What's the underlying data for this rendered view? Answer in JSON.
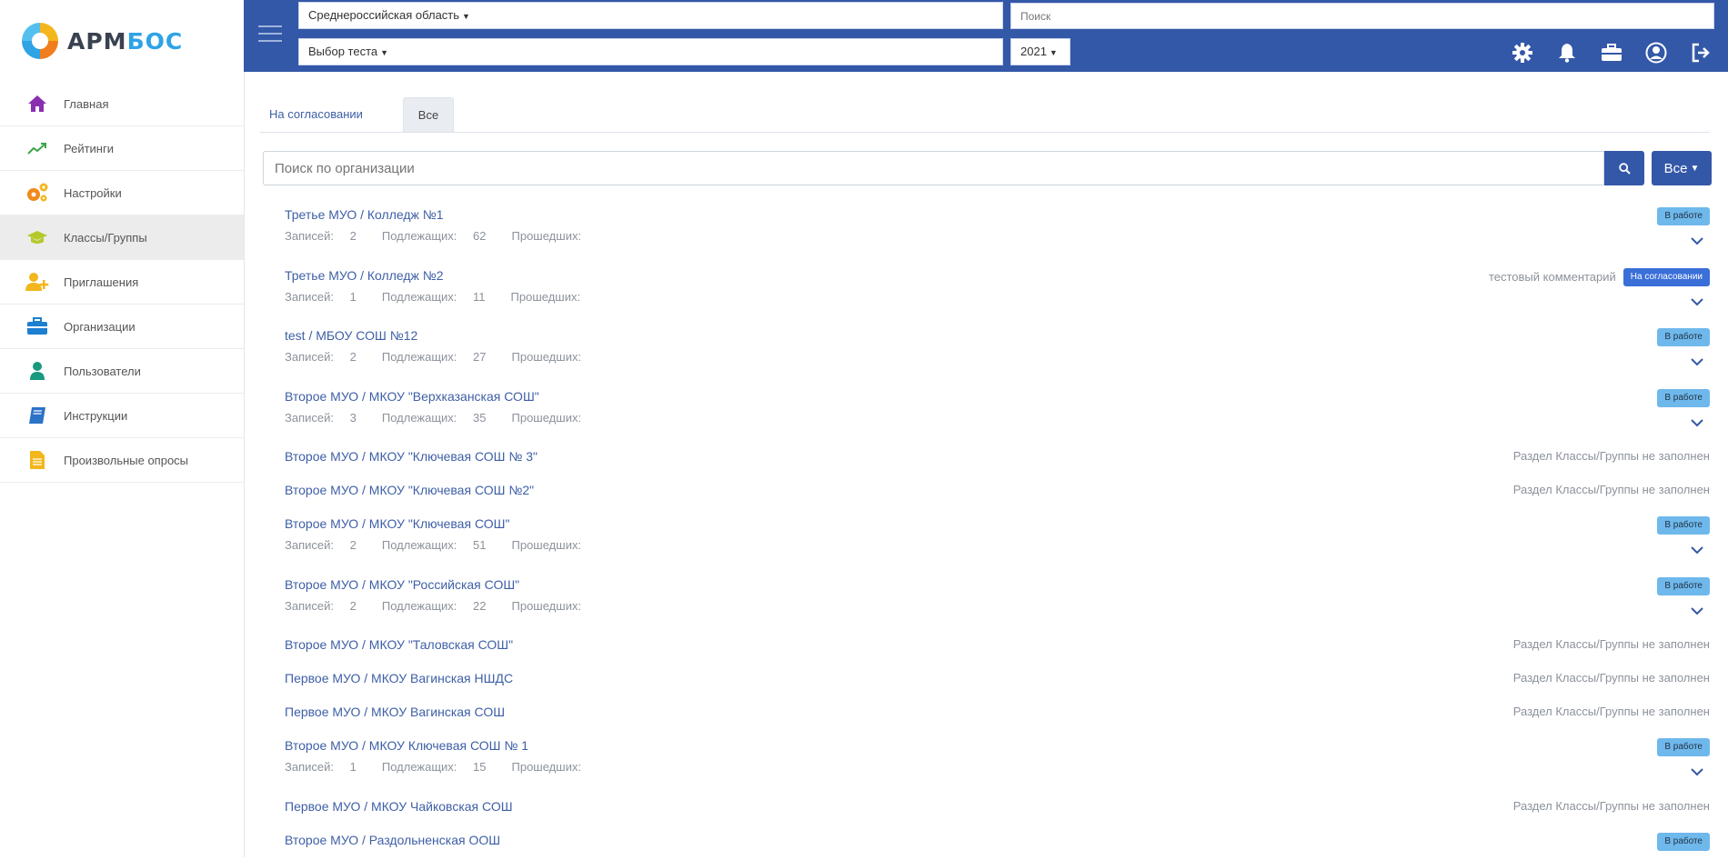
{
  "brand": {
    "part1": "АРМ",
    "part2": "БОС"
  },
  "sidebar": {
    "items": [
      {
        "label": "Главная",
        "icon": "home-icon"
      },
      {
        "label": "Рейтинги",
        "icon": "trend-icon"
      },
      {
        "label": "Настройки",
        "icon": "gears-icon"
      },
      {
        "label": "Классы/Группы",
        "icon": "graduation-cap-icon"
      },
      {
        "label": "Приглашения",
        "icon": "user-plus-icon"
      },
      {
        "label": "Организации",
        "icon": "briefcase-icon"
      },
      {
        "label": "Пользователи",
        "icon": "user-icon"
      },
      {
        "label": "Инструкции",
        "icon": "book-icon"
      },
      {
        "label": "Произвольные опросы",
        "icon": "document-icon"
      }
    ]
  },
  "header": {
    "region": "Среднероссийская область",
    "test": "Выбор теста",
    "year": "2021",
    "search_placeholder": "Поиск"
  },
  "tabs": [
    "На согласовании",
    "Все"
  ],
  "search": {
    "placeholder": "Поиск по организации",
    "filter_label": "Все"
  },
  "labels": {
    "records": "Записей:",
    "subject": "Подлежащих:",
    "passed": "Прошедших:"
  },
  "rows": [
    {
      "org": "Третье МУО / Колледж №1",
      "records": "2",
      "subject": "62",
      "status": "В работе"
    },
    {
      "org": "Третье МУО / Колледж №2",
      "records": "1",
      "subject": "11",
      "status": "На согласовании",
      "comment": "тестовый комментарий"
    },
    {
      "org": "test / МБОУ СОШ №12",
      "records": "2",
      "subject": "27",
      "status": "В работе"
    },
    {
      "org": "Второе МУО / МКОУ \"Верхказанская СОШ\"",
      "records": "3",
      "subject": "35",
      "status": "В работе"
    },
    {
      "org": "Второе МУО / МКОУ \"Ключевая СОШ № 3\"",
      "empty": "Раздел Классы/Группы не заполнен"
    },
    {
      "org": "Второе МУО / МКОУ \"Ключевая СОШ №2\"",
      "empty": "Раздел Классы/Группы не заполнен"
    },
    {
      "org": "Второе МУО / МКОУ \"Ключевая СОШ\"",
      "records": "2",
      "subject": "51",
      "status": "В работе"
    },
    {
      "org": "Второе МУО / МКОУ \"Российская СОШ\"",
      "records": "2",
      "subject": "22",
      "status": "В работе"
    },
    {
      "org": "Второе МУО / МКОУ \"Таловская СОШ\"",
      "empty": "Раздел Классы/Группы не заполнен"
    },
    {
      "org": "Первое МУО / МКОУ Вагинская НШДС",
      "empty": "Раздел Классы/Группы не заполнен"
    },
    {
      "org": "Первое МУО / МКОУ Вагинская СОШ",
      "empty": "Раздел Классы/Группы не заполнен"
    },
    {
      "org": "Второе МУО / МКОУ Ключевая СОШ № 1",
      "records": "1",
      "subject": "15",
      "status": "В работе"
    },
    {
      "org": "Первое МУО / МКОУ Чайковская СОШ",
      "empty": "Раздел Классы/Группы не заполнен"
    },
    {
      "org": "Второе МУО / Раздольненская ООШ",
      "status": "В работе"
    }
  ],
  "colors": {
    "header": "#3458a8",
    "badge_work": "#6fb8ec",
    "badge_approval": "#3a6fd8",
    "link": "#3e5fa6"
  }
}
